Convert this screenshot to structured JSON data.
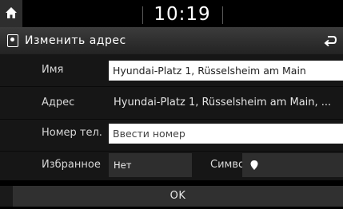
{
  "status": {
    "time": "10:19"
  },
  "header": {
    "title": "Изменить адрес"
  },
  "form": {
    "name_label": "Имя",
    "name_value": "Hyundai-Platz 1, Rüsselsheim am Main",
    "address_label": "Адрес",
    "address_value": "Hyundai-Platz 1, Rüsselsheim am Main, ...",
    "phone_label": "Номер тел.",
    "phone_placeholder": "Ввести номер",
    "favorite_label": "Избранное",
    "favorite_value": "Нет",
    "symbol_label": "Символ"
  },
  "footer": {
    "ok_label": "OK"
  },
  "colors": {
    "background": "#000000",
    "field": "#ffffff",
    "button": "#303030"
  },
  "icons": {
    "home": "home-icon",
    "title": "location-pin-icon",
    "back": "back-arrow-icon",
    "symbol": "pin-icon"
  }
}
